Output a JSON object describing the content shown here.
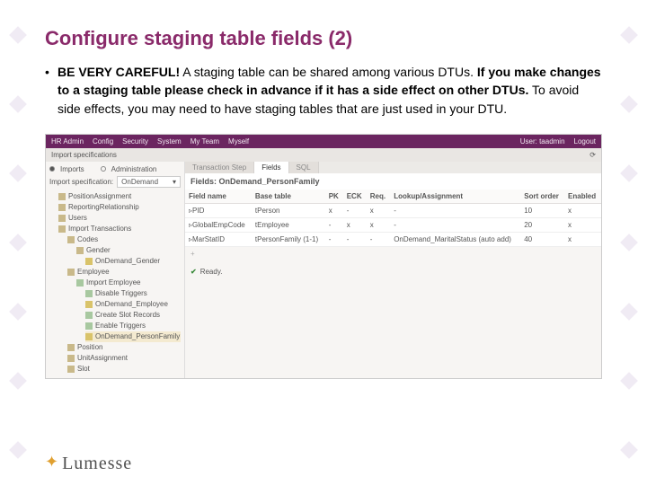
{
  "slide": {
    "title": "Configure staging table fields (2)",
    "bullet": {
      "strong1": "BE VERY CAREFUL!",
      "text1": " A staging table can be shared among various DTUs. ",
      "strong2": "If you make changes to a staging table please check in advance if it has a side effect on other DTUs.",
      "text2": " To avoid side effects, you may need to have staging tables that are just used in your DTU."
    }
  },
  "app": {
    "topmenu": [
      "HR Admin",
      "Config",
      "Security",
      "System",
      "My Team",
      "Myself"
    ],
    "user_label": "User: taadmin",
    "logout": "Logout",
    "subbar_title": "Import specifications",
    "radios": {
      "imports": "Imports",
      "admin": "Administration"
    },
    "spec_label": "Import specification:",
    "spec_value": "OnDemand",
    "tree": {
      "n0": "PositionAssignment",
      "n1": "ReportingRelationship",
      "n2": "Users",
      "n3": "Import Transactions",
      "n4": "Codes",
      "n5": "Gender",
      "n6": "OnDemand_Gender",
      "n7": "Employee",
      "n8": "Import Employee",
      "n9": "Disable Triggers",
      "n10": "OnDemand_Employee",
      "n11": "Create Slot Records",
      "n12": "Enable Triggers",
      "n13": "OnDemand_PersonFamily",
      "n14": "Position",
      "n15": "UnitAssignment",
      "n16": "Slot"
    },
    "tabs": {
      "t1": "Transaction Step",
      "t2": "Fields",
      "t3": "SQL"
    },
    "panel_title": "Fields: OnDemand_PersonFamily",
    "cols": {
      "c1": "Field name",
      "c2": "Base table",
      "c3": "PK",
      "c4": "ECK",
      "c5": "Req.",
      "c6": "Lookup/Assignment",
      "c7": "Sort order",
      "c8": "Enabled"
    },
    "rows": [
      {
        "f": "PID",
        "b": "tPerson",
        "pk": "x",
        "eck": "-",
        "req": "x",
        "la": "-",
        "so": "10",
        "en": "x"
      },
      {
        "f": "GlobalEmpCode",
        "b": "tEmployee",
        "pk": "-",
        "eck": "x",
        "req": "x",
        "la": "-",
        "so": "20",
        "en": "x"
      },
      {
        "f": "MarStatID",
        "b": "tPersonFamily (1-1)",
        "pk": "-",
        "eck": "-",
        "req": "-",
        "la": "OnDemand_MaritalStatus (auto add)",
        "so": "40",
        "en": "x"
      }
    ],
    "ready": "Ready."
  },
  "logo": "Lumesse"
}
